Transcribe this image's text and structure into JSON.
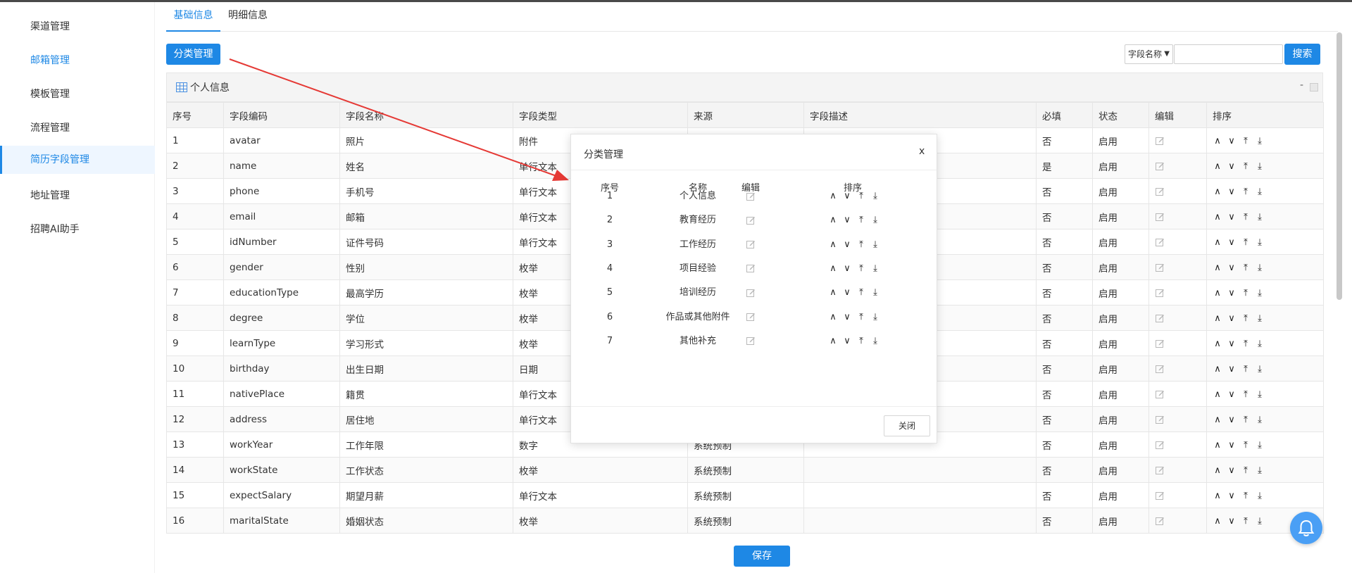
{
  "sidebar": {
    "items": [
      {
        "label": "渠道管理"
      },
      {
        "label": "邮箱管理"
      },
      {
        "label": "模板管理"
      },
      {
        "label": "流程管理"
      },
      {
        "label": "简历字段管理"
      },
      {
        "label": "地址管理"
      },
      {
        "label": "招聘AI助手"
      }
    ]
  },
  "tabs": [
    {
      "label": "基础信息"
    },
    {
      "label": "明细信息"
    }
  ],
  "toolbar": {
    "category_button": "分类管理",
    "select_value": "字段名称",
    "search_button": "搜索"
  },
  "panel": {
    "title": "个人信息",
    "collapse": "-"
  },
  "table": {
    "headers": [
      "序号",
      "字段编码",
      "字段名称",
      "字段类型",
      "来源",
      "字段描述",
      "必填",
      "状态",
      "编辑",
      "排序"
    ],
    "rows": [
      {
        "no": "1",
        "code": "avatar",
        "name": "照片",
        "type": "附件",
        "source": "",
        "required": "否",
        "status": "启用"
      },
      {
        "no": "2",
        "code": "name",
        "name": "姓名",
        "type": "单行文本",
        "source": "",
        "required": "是",
        "status": "启用"
      },
      {
        "no": "3",
        "code": "phone",
        "name": "手机号",
        "type": "单行文本",
        "source": "",
        "required": "否",
        "status": "启用"
      },
      {
        "no": "4",
        "code": "email",
        "name": "邮箱",
        "type": "单行文本",
        "source": "",
        "required": "否",
        "status": "启用"
      },
      {
        "no": "5",
        "code": "idNumber",
        "name": "证件号码",
        "type": "单行文本",
        "source": "",
        "required": "否",
        "status": "启用"
      },
      {
        "no": "6",
        "code": "gender",
        "name": "性别",
        "type": "枚举",
        "source": "",
        "required": "否",
        "status": "启用"
      },
      {
        "no": "7",
        "code": "educationType",
        "name": "最高学历",
        "type": "枚举",
        "source": "",
        "required": "否",
        "status": "启用"
      },
      {
        "no": "8",
        "code": "degree",
        "name": "学位",
        "type": "枚举",
        "source": "",
        "required": "否",
        "status": "启用"
      },
      {
        "no": "9",
        "code": "learnType",
        "name": "学习形式",
        "type": "枚举",
        "source": "",
        "required": "否",
        "status": "启用"
      },
      {
        "no": "10",
        "code": "birthday",
        "name": "出生日期",
        "type": "日期",
        "source": "",
        "required": "否",
        "status": "启用"
      },
      {
        "no": "11",
        "code": "nativePlace",
        "name": "籍贯",
        "type": "单行文本",
        "source": "",
        "required": "否",
        "status": "启用"
      },
      {
        "no": "12",
        "code": "address",
        "name": "居住地",
        "type": "单行文本",
        "source": "",
        "required": "否",
        "status": "启用"
      },
      {
        "no": "13",
        "code": "workYear",
        "name": "工作年限",
        "type": "数字",
        "source": "系统预制",
        "required": "否",
        "status": "启用"
      },
      {
        "no": "14",
        "code": "workState",
        "name": "工作状态",
        "type": "枚举",
        "source": "系统预制",
        "required": "否",
        "status": "启用"
      },
      {
        "no": "15",
        "code": "expectSalary",
        "name": "期望月薪",
        "type": "单行文本",
        "source": "系统预制",
        "required": "否",
        "status": "启用"
      },
      {
        "no": "16",
        "code": "maritalState",
        "name": "婚姻状态",
        "type": "枚举",
        "source": "系统预制",
        "required": "否",
        "status": "启用"
      }
    ]
  },
  "modal": {
    "title": "分类管理",
    "close_x": "x",
    "headers": [
      "序号",
      "名称",
      "编辑",
      "排序"
    ],
    "rows": [
      {
        "no": "1",
        "name": "个人信息"
      },
      {
        "no": "2",
        "name": "教育经历"
      },
      {
        "no": "3",
        "name": "工作经历"
      },
      {
        "no": "4",
        "name": "项目经验"
      },
      {
        "no": "5",
        "name": "培训经历"
      },
      {
        "no": "6",
        "name": "作品或其他附件"
      },
      {
        "no": "7",
        "name": "其他补充"
      }
    ],
    "close_button": "关闭"
  },
  "footer": {
    "save_button": "保存"
  },
  "icons": {
    "sort": [
      "chevron-up-icon",
      "chevron-down-icon",
      "move-top-icon",
      "move-bottom-icon"
    ],
    "edit": "edit-icon",
    "bell": "bell-icon"
  },
  "colors": {
    "primary": "#1e88e5",
    "arrow": "#e53935"
  }
}
